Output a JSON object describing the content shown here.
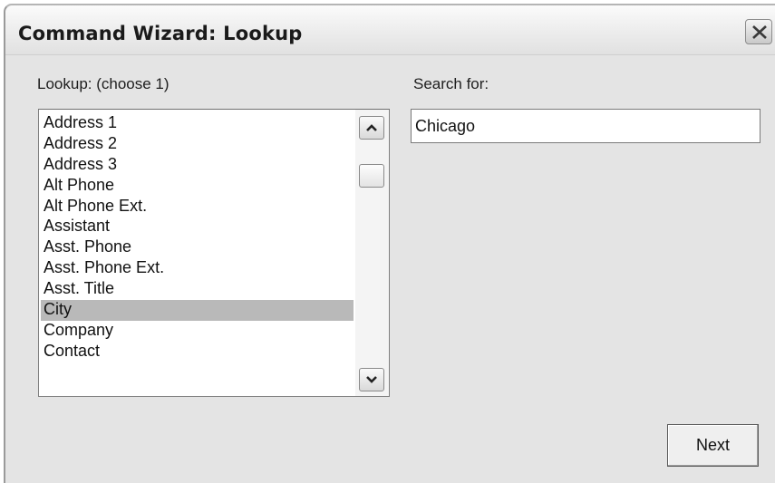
{
  "window": {
    "title": "Command Wizard: Lookup"
  },
  "lookup": {
    "label": "Lookup: (choose 1)",
    "items": [
      "Address 1",
      "Address 2",
      "Address 3",
      "Alt Phone",
      "Alt Phone Ext.",
      "Assistant",
      "Asst. Phone",
      "Asst. Phone Ext.",
      "Asst. Title",
      "City",
      "Company",
      "Contact"
    ],
    "selected": "City"
  },
  "search": {
    "label": "Search for:",
    "value": "Chicago"
  },
  "buttons": {
    "next_label": "Next"
  },
  "icons": {
    "close": "close-icon",
    "scroll_up": "chevron-up-icon",
    "scroll_down": "chevron-down-icon"
  }
}
